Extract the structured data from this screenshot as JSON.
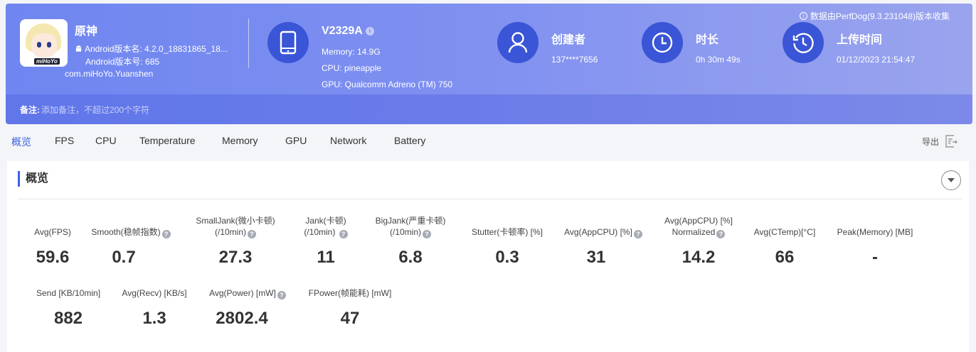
{
  "header": {
    "source_note": "数据由PerfDog(9.3.231048)版本收集",
    "app": {
      "name": "原神",
      "version_name": "Android版本名: 4.2.0_18831865_18...",
      "version_code": "Android版本号: 685",
      "package": "com.miHoYo.Yuanshen",
      "icon_logo_text": "miHoYo"
    },
    "device": {
      "model": "V2329A",
      "memory": "Memory: 14.9G",
      "cpu": "CPU: pineapple",
      "gpu": "GPU: Qualcomm Adreno (TM) 750"
    },
    "creator": {
      "label": "创建者",
      "value": "137****7656"
    },
    "duration": {
      "label": "时长",
      "value": "0h 30m 49s"
    },
    "upload": {
      "label": "上传时间",
      "value": "01/12/2023 21:54:47"
    },
    "note": {
      "label": "备注:",
      "placeholder": "添加备注，不超过200个字符"
    }
  },
  "tabs": [
    {
      "label": "概览",
      "active": true
    },
    {
      "label": "FPS"
    },
    {
      "label": "CPU"
    },
    {
      "label": "Temperature"
    },
    {
      "label": "Memory"
    },
    {
      "label": "GPU"
    },
    {
      "label": "Network"
    },
    {
      "label": "Battery"
    }
  ],
  "export_label": "导出",
  "overview": {
    "title": "概览",
    "metrics": [
      {
        "label1": "Avg(FPS)",
        "value": "59.6"
      },
      {
        "label1": "Smooth(稳帧指数)",
        "value": "0.7",
        "help": true
      },
      {
        "label1": "SmallJank(微小卡顿)",
        "label2": "(/10min)",
        "value": "27.3",
        "help": true
      },
      {
        "label1": "Jank(卡顿)",
        "label2": "(/10min)",
        "value": "11",
        "help": true
      },
      {
        "label1": "BigJank(严重卡顿)",
        "label2": "(/10min)",
        "value": "6.8",
        "help": true
      },
      {
        "label1": "Stutter(卡顿率) [%]",
        "value": "0.3"
      },
      {
        "label1": "Avg(AppCPU) [%]",
        "value": "31",
        "help": true
      },
      {
        "label1": "Avg(AppCPU) [%]",
        "label2": "Normalized",
        "value": "14.2",
        "help": true
      },
      {
        "label1": "Avg(CTemp)[°C]",
        "value": "66"
      },
      {
        "label1": "Peak(Memory) [MB]",
        "value": "-"
      },
      {
        "label1": "Send [KB/10min]",
        "value": "882"
      },
      {
        "label1": "Avg(Recv) [KB/s]",
        "value": "1.3"
      },
      {
        "label1": "Avg(Power) [mW]",
        "value": "2802.4",
        "help": true
      },
      {
        "label1": "FPower(帧能耗) [mW]",
        "value": "47"
      }
    ]
  },
  "colors": {
    "accent": "#3a63e0",
    "icon_circle": "#3a55d6"
  }
}
